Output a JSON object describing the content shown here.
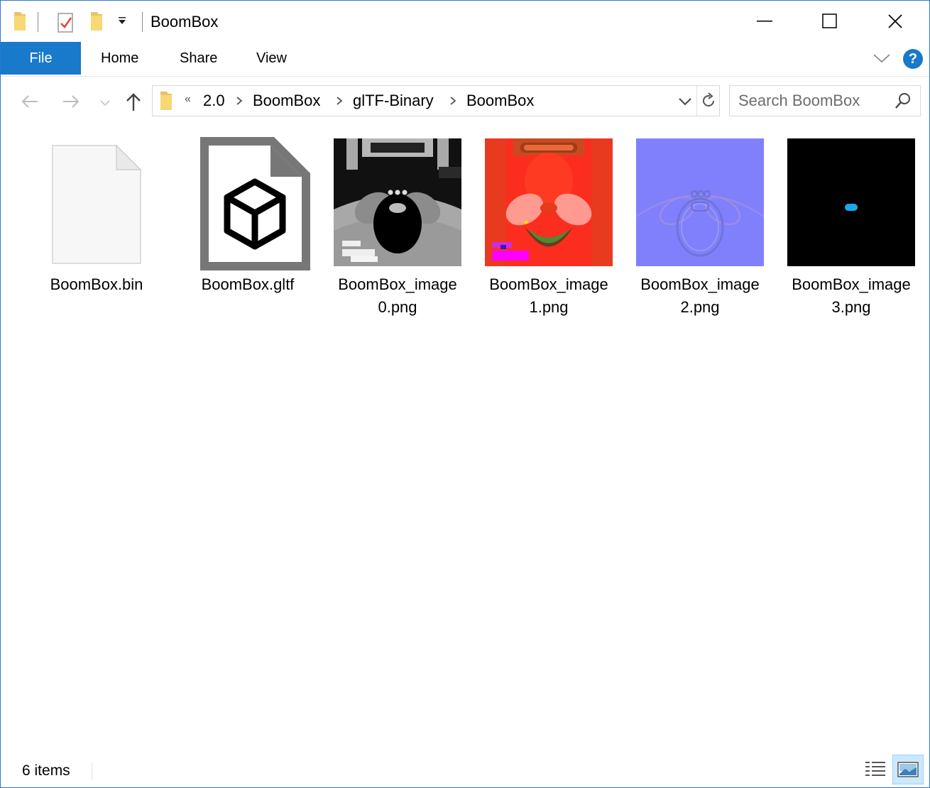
{
  "window": {
    "title": "BoomBox",
    "accent": "#1979ca",
    "quick_access_icons": [
      "folder-icon",
      "properties-checkmark-icon",
      "new-folder-icon",
      "customize-dropdown-icon"
    ],
    "controls": [
      "minimize-icon",
      "maximize-icon",
      "close-icon"
    ]
  },
  "ribbon": {
    "tabs": [
      {
        "label": "File",
        "active": true
      },
      {
        "label": "Home"
      },
      {
        "label": "Share"
      },
      {
        "label": "View"
      }
    ],
    "help_label": "?"
  },
  "address": {
    "overflow": "«",
    "crumbs": [
      "2.0",
      "BoomBox",
      "glTF-Binary",
      "BoomBox"
    ]
  },
  "search": {
    "placeholder": "Search BoomBox"
  },
  "files": [
    {
      "name": "BoomBox.bin",
      "kind": "generic-file-icon"
    },
    {
      "name": "BoomBox.gltf",
      "kind": "3d-object-file-icon"
    },
    {
      "name": "BoomBox_image0.png",
      "line1": "BoomBox_image",
      "line2": "0.png",
      "kind": "occlusion-texture-thumbnail"
    },
    {
      "name": "BoomBox_image1.png",
      "line1": "BoomBox_image",
      "line2": "1.png",
      "kind": "roughness-metal-texture-thumbnail"
    },
    {
      "name": "BoomBox_image2.png",
      "line1": "BoomBox_image",
      "line2": "2.png",
      "kind": "normal-map-thumbnail"
    },
    {
      "name": "BoomBox_image3.png",
      "line1": "BoomBox_image",
      "line2": "3.png",
      "kind": "emissive-texture-thumbnail"
    }
  ],
  "status": {
    "item_count": "6 items"
  }
}
